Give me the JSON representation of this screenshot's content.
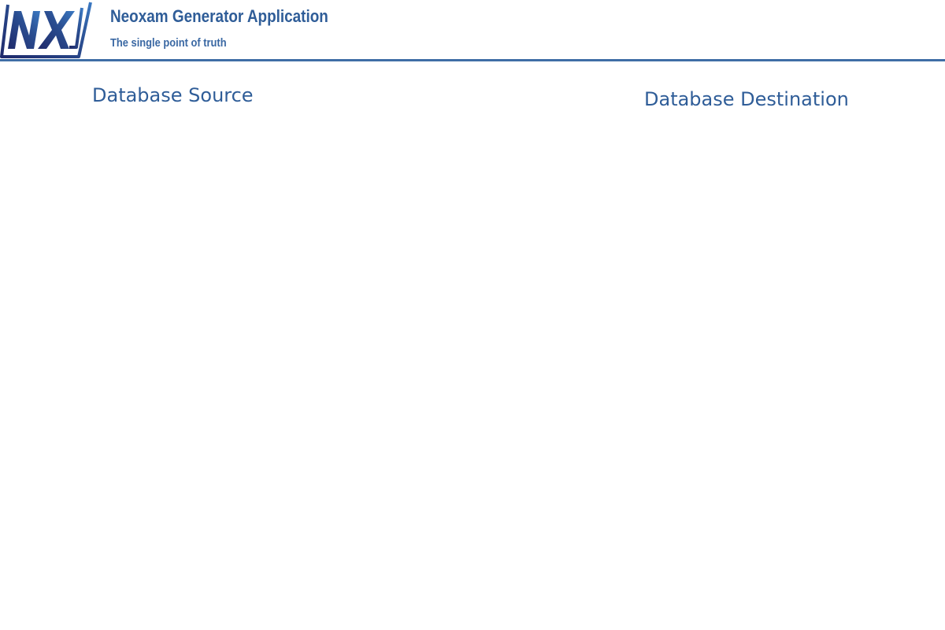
{
  "header": {
    "logo_icon": "nx-logo-icon",
    "title": "Neoxam Generator Application",
    "tagline": "The single point of truth"
  },
  "sections": {
    "source": {
      "title": "Database Source"
    },
    "destination": {
      "title": "Database Destination"
    }
  },
  "colors": {
    "brand_blue": "#2f5d98",
    "rule": "#3f6ea6",
    "logo_dark": "#1f2a6b",
    "logo_light": "#3b79c2"
  }
}
